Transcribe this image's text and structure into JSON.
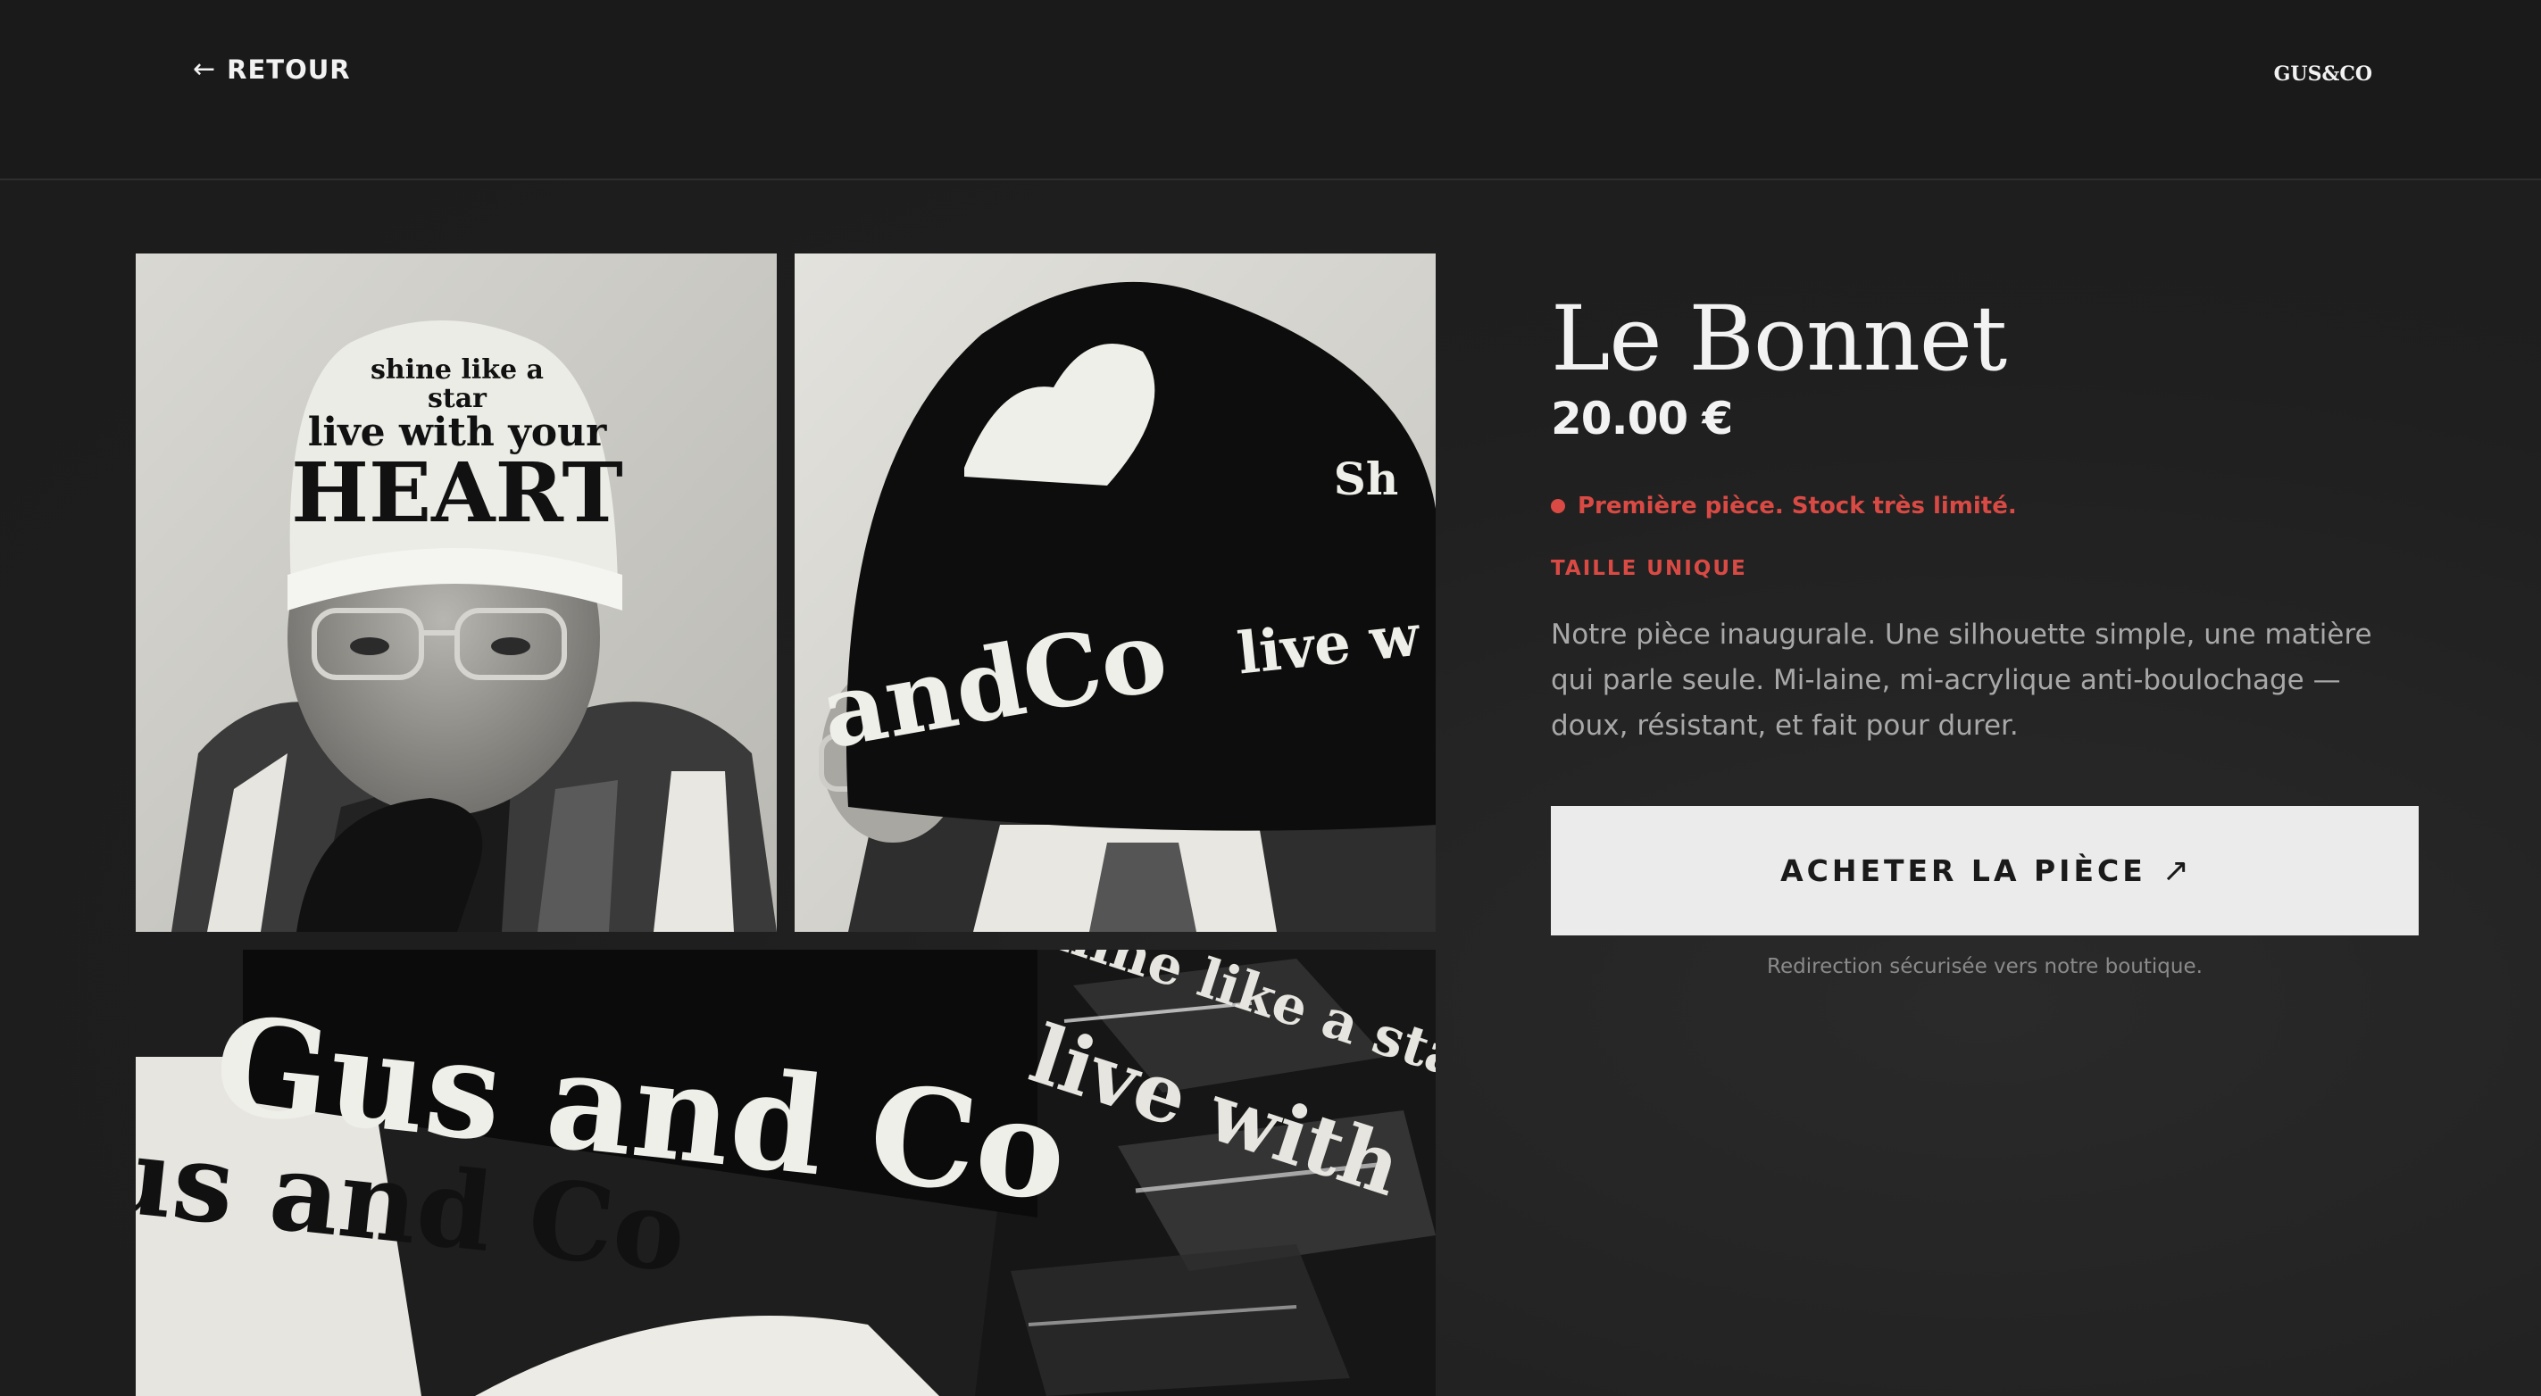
{
  "header": {
    "back_label": "RETOUR",
    "back_icon": "arrow-left-icon",
    "brand": "GUS&CO"
  },
  "gallery": {
    "photos": [
      {
        "name": "beanie-front-photo",
        "knit_text": [
          "shine like a",
          "star",
          "live with your",
          "HEART"
        ]
      },
      {
        "name": "beanie-back-photo",
        "knit_text": [
          "andCo",
          "live w",
          "Sh"
        ]
      },
      {
        "name": "beanie-flatlay-photo",
        "knit_text": [
          "Gus and Co",
          "Gus and Co",
          "live with",
          "shine like a star"
        ]
      }
    ]
  },
  "product": {
    "title": "Le Bonnet",
    "price": "20.00 €",
    "stock_notice": "Première pièce. Stock très limité.",
    "size": "TAILLE UNIQUE",
    "description": "Notre pièce inaugurale. Une silhouette simple, une matière qui parle seule. Mi-laine, mi-acrylique anti-boulochage — doux, résistant, et fait pour durer.",
    "buy_label": "ACHETER LA PIÈCE",
    "buy_icon": "external-arrow-icon",
    "redirect_note": "Redirection sécurisée vers notre boutique."
  },
  "colors": {
    "background": "#1c1c1c",
    "accent_red": "#d94a44",
    "button_bg": "#ebebeb",
    "text_primary": "#f2f2f2",
    "text_muted": "#a8a8a8"
  }
}
